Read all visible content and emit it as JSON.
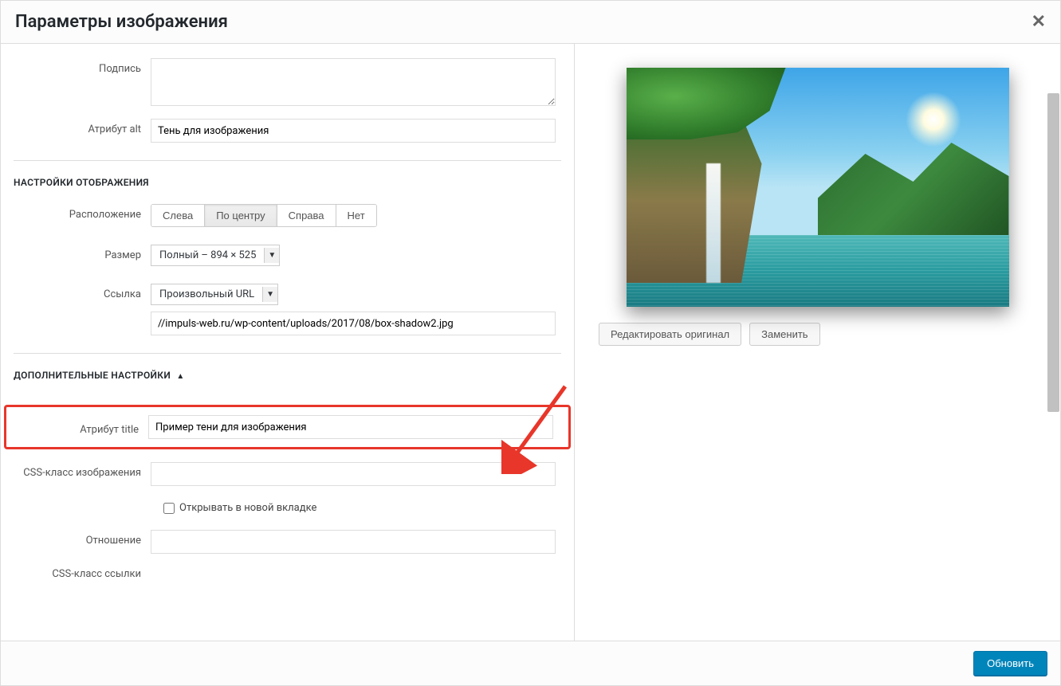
{
  "dialog": {
    "title": "Параметры изображения"
  },
  "fields": {
    "caption_label": "Подпись",
    "caption_value": "",
    "alt_label": "Атрибут alt",
    "alt_value": "Тень для изображения"
  },
  "display_section": {
    "header": "НАСТРОЙКИ ОТОБРАЖЕНИЯ",
    "align_label": "Расположение",
    "align_options": {
      "left": "Слева",
      "center": "По центру",
      "right": "Справа",
      "none": "Нет"
    },
    "align_selected": "center",
    "size_label": "Размер",
    "size_value": "Полный – 894 × 525",
    "link_label": "Ссылка",
    "link_type": "Произвольный URL",
    "link_url": "//impuls-web.ru/wp-content/uploads/2017/08/box-shadow2.jpg"
  },
  "advanced_section": {
    "header": "ДОПОЛНИТЕЛЬНЫЕ НАСТРОЙКИ",
    "title_label": "Атрибут title",
    "title_value": "Пример тени для изображения",
    "css_class_label": "CSS-класс изображения",
    "css_class_value": "",
    "new_tab_label": "Открывать в новой вкладке",
    "rel_label": "Отношение",
    "rel_value": "",
    "link_css_label": "CSS-класс ссылки"
  },
  "preview": {
    "edit_original": "Редактировать оригинал",
    "replace": "Заменить"
  },
  "footer": {
    "update": "Обновить"
  }
}
